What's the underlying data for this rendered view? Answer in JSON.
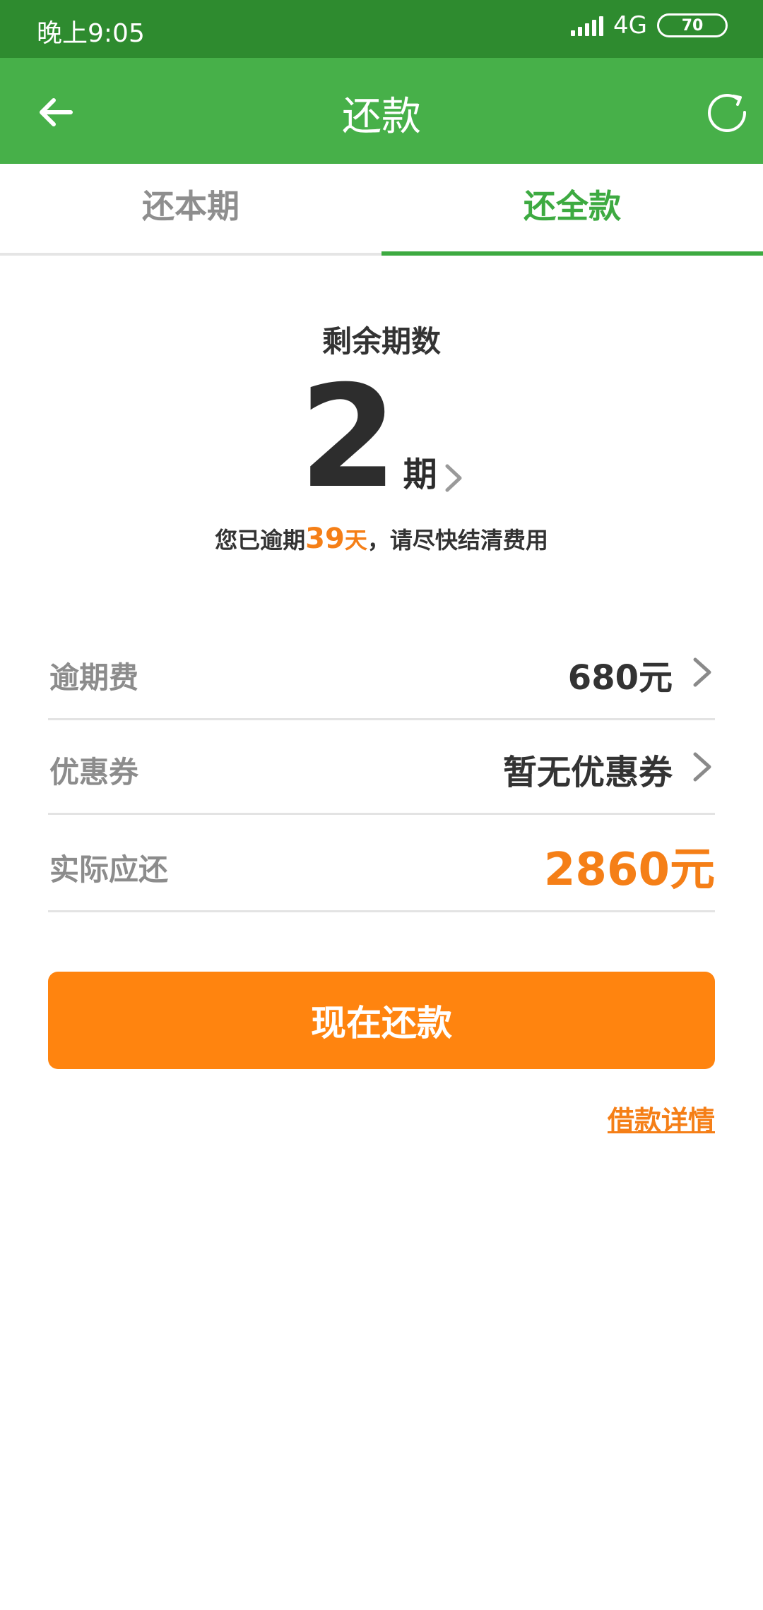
{
  "status_bar": {
    "time": "晚上9:05",
    "network": "4G",
    "battery": "70"
  },
  "header": {
    "title": "还款"
  },
  "tabs": [
    {
      "label": "还本期",
      "active": false
    },
    {
      "label": "还全款",
      "active": true
    }
  ],
  "summary": {
    "remaining_label": "剩余期数",
    "remaining_count": "2",
    "remaining_unit": "期",
    "overdue_prefix": "您已逾期",
    "overdue_days": "39",
    "overdue_days_unit": "天",
    "overdue_suffix": "，请尽快结清费用"
  },
  "rows": [
    {
      "label": "逾期费",
      "value": "680元"
    },
    {
      "label": "优惠券",
      "value": "暂无优惠券"
    },
    {
      "label": "实际应还",
      "value": "2860元"
    }
  ],
  "actions": {
    "pay_now": "现在还款",
    "loan_details": "借款详情"
  },
  "colors": {
    "status_bar": "#2e8b2f",
    "app_bar": "#47b049",
    "accent_green": "#3daa41",
    "accent_orange": "#ff840f"
  }
}
